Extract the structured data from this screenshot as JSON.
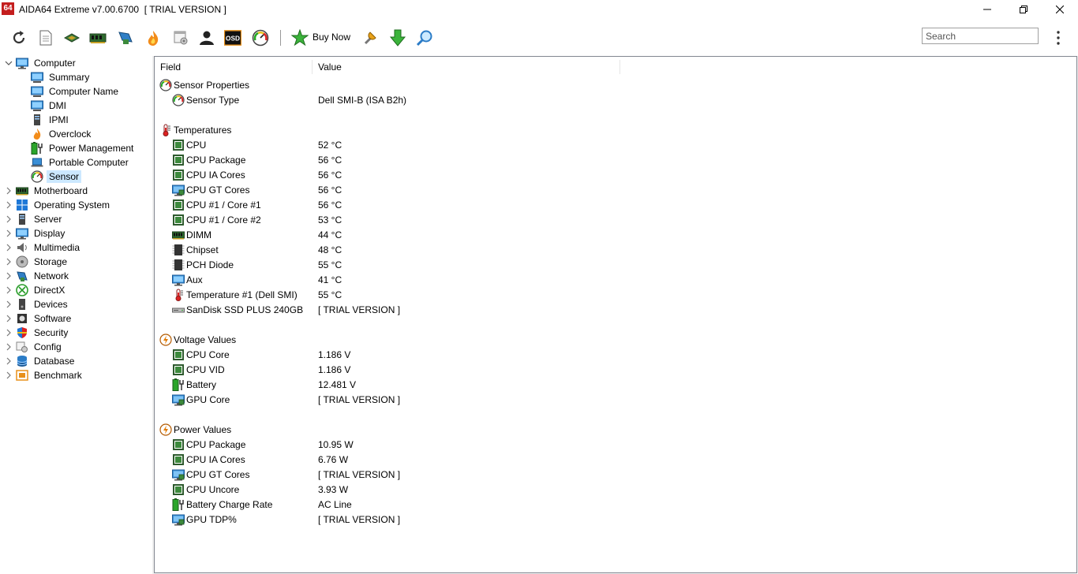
{
  "window": {
    "title": "AIDA64 Extreme v7.00.6700  [ TRIAL VERSION ]",
    "icon_text": "64"
  },
  "toolbar": {
    "buy_now_label": "Buy Now",
    "search_placeholder": "Search"
  },
  "tree": {
    "computer": "Computer",
    "children": [
      "Summary",
      "Computer Name",
      "DMI",
      "IPMI",
      "Overclock",
      "Power Management",
      "Portable Computer",
      "Sensor"
    ],
    "selected": "Sensor",
    "categories": [
      "Motherboard",
      "Operating System",
      "Server",
      "Display",
      "Multimedia",
      "Storage",
      "Network",
      "DirectX",
      "Devices",
      "Software",
      "Security",
      "Config",
      "Database",
      "Benchmark"
    ]
  },
  "list": {
    "col_field": "Field",
    "col_value": "Value",
    "sensor_properties": {
      "title": "Sensor Properties",
      "rows": [
        {
          "field": "Sensor Type",
          "value": "Dell SMI-B  (ISA B2h)",
          "icon": "gauge-icon"
        }
      ]
    },
    "temperatures": {
      "title": "Temperatures",
      "rows": [
        {
          "field": "CPU",
          "value": "52 °C",
          "icon": "chip-icon"
        },
        {
          "field": "CPU Package",
          "value": "56 °C",
          "icon": "chip-icon"
        },
        {
          "field": "CPU IA Cores",
          "value": "56 °C",
          "icon": "chip-icon"
        },
        {
          "field": "CPU GT Cores",
          "value": "56 °C",
          "icon": "gpu-monitor-icon"
        },
        {
          "field": "CPU #1 / Core #1",
          "value": "56 °C",
          "icon": "chip-icon"
        },
        {
          "field": "CPU #1 / Core #2",
          "value": "53 °C",
          "icon": "chip-icon"
        },
        {
          "field": "DIMM",
          "value": "44 °C",
          "icon": "memory-icon"
        },
        {
          "field": "Chipset",
          "value": "48 °C",
          "icon": "chipset-icon"
        },
        {
          "field": "PCH Diode",
          "value": "55 °C",
          "icon": "chipset-icon"
        },
        {
          "field": "Aux",
          "value": "41 °C",
          "icon": "monitor-icon"
        },
        {
          "field": "Temperature #1 (Dell SMI)",
          "value": "55 °C",
          "icon": "thermometer-icon"
        },
        {
          "field": "SanDisk SSD PLUS 240GB",
          "value": "[ TRIAL VERSION ]",
          "icon": "drive-icon"
        }
      ]
    },
    "voltages": {
      "title": "Voltage Values",
      "rows": [
        {
          "field": "CPU Core",
          "value": "1.186 V",
          "icon": "chip-icon"
        },
        {
          "field": "CPU VID",
          "value": "1.186 V",
          "icon": "chip-icon"
        },
        {
          "field": "Battery",
          "value": "12.481 V",
          "icon": "battery-icon"
        },
        {
          "field": "GPU Core",
          "value": "[ TRIAL VERSION ]",
          "icon": "gpu-monitor-icon"
        }
      ]
    },
    "power": {
      "title": "Power Values",
      "rows": [
        {
          "field": "CPU Package",
          "value": "10.95 W",
          "icon": "chip-icon"
        },
        {
          "field": "CPU IA Cores",
          "value": "6.76 W",
          "icon": "chip-icon"
        },
        {
          "field": "CPU GT Cores",
          "value": "[ TRIAL VERSION ]",
          "icon": "gpu-monitor-icon"
        },
        {
          "field": "CPU Uncore",
          "value": "3.93 W",
          "icon": "chip-icon"
        },
        {
          "field": "Battery Charge Rate",
          "value": "AC Line",
          "icon": "battery-icon"
        },
        {
          "field": "GPU TDP%",
          "value": "[ TRIAL VERSION ]",
          "icon": "gpu-monitor-icon"
        }
      ]
    }
  }
}
